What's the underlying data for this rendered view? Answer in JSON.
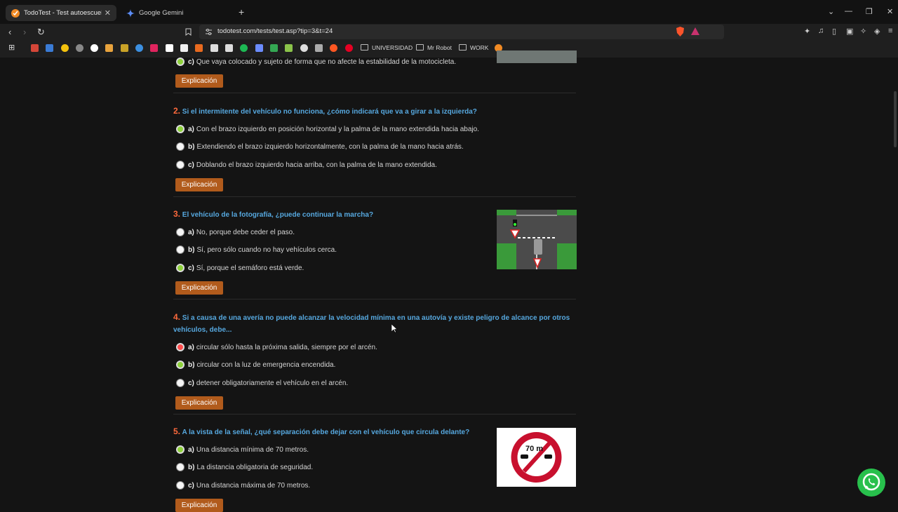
{
  "browser": {
    "tabs": [
      {
        "title": "TodoTest - Test autoescuela gratis",
        "active": true
      },
      {
        "title": "Google Gemini",
        "active": false
      }
    ],
    "url": "todotest.com/tests/test.asp?tip=3&t=24",
    "bookmarks": {
      "folders": [
        "UNIVERSIDAD",
        "Mr Robot",
        "WORK"
      ]
    }
  },
  "quiz": {
    "q1": {
      "answer_c": {
        "letter": "c)",
        "text": "Que vaya colocado y sujeto de forma que no afecte la estabilidad de la motocicleta.",
        "state": "correct"
      }
    },
    "questions": [
      {
        "number": "2.",
        "title": "Si el intermitente del vehículo no funciona, ¿cómo indicará que va a girar a la izquierda?",
        "answers": [
          {
            "letter": "a)",
            "text": "Con el brazo izquierdo en posición horizontal y la palma de la mano extendida hacia abajo.",
            "state": "correct"
          },
          {
            "letter": "b)",
            "text": "Extendiendo el brazo izquierdo horizontalmente, con la palma de la mano hacia atrás.",
            "state": "none"
          },
          {
            "letter": "c)",
            "text": "Doblando el brazo izquierdo hacia arriba, con la palma de la mano extendida.",
            "state": "none"
          }
        ]
      },
      {
        "number": "3.",
        "title": "El vehículo de la fotografía, ¿puede continuar la marcha?",
        "answers": [
          {
            "letter": "a)",
            "text": "No, porque debe ceder el paso.",
            "state": "none"
          },
          {
            "letter": "b)",
            "text": "Sí, pero sólo cuando no hay vehículos cerca.",
            "state": "none"
          },
          {
            "letter": "c)",
            "text": "Sí, porque el semáforo está verde.",
            "state": "correct"
          }
        ]
      },
      {
        "number": "4.",
        "title": "Si a causa de una avería no puede alcanzar la velocidad mínima en una autovía y existe peligro de alcance por otros vehículos, debe...",
        "answers": [
          {
            "letter": "a)",
            "text": "circular sólo hasta la próxima salida, siempre por el arcén.",
            "state": "wrong"
          },
          {
            "letter": "b)",
            "text": "circular con la luz de emergencia encendida.",
            "state": "correct"
          },
          {
            "letter": "c)",
            "text": "detener obligatoriamente el vehículo en el arcén.",
            "state": "none"
          }
        ]
      },
      {
        "number": "5.",
        "title": "A la vista de la señal, ¿qué separación debe dejar con el vehículo que circula delante?",
        "answers": [
          {
            "letter": "a)",
            "text": "Una distancia mínima de 70 metros.",
            "state": "correct"
          },
          {
            "letter": "b)",
            "text": "La distancia obligatoria de seguridad.",
            "state": "none"
          },
          {
            "letter": "c)",
            "text": "Una distancia máxima de 70 metros.",
            "state": "none"
          }
        ]
      }
    ],
    "explain_label": "Explicación",
    "sign_text": "70 m"
  },
  "colors": {
    "correct": "#8ed23a",
    "wrong": "#ff4d4d",
    "title": "#56a8df",
    "number": "#ff6a3d",
    "button": "#b15b1c"
  }
}
